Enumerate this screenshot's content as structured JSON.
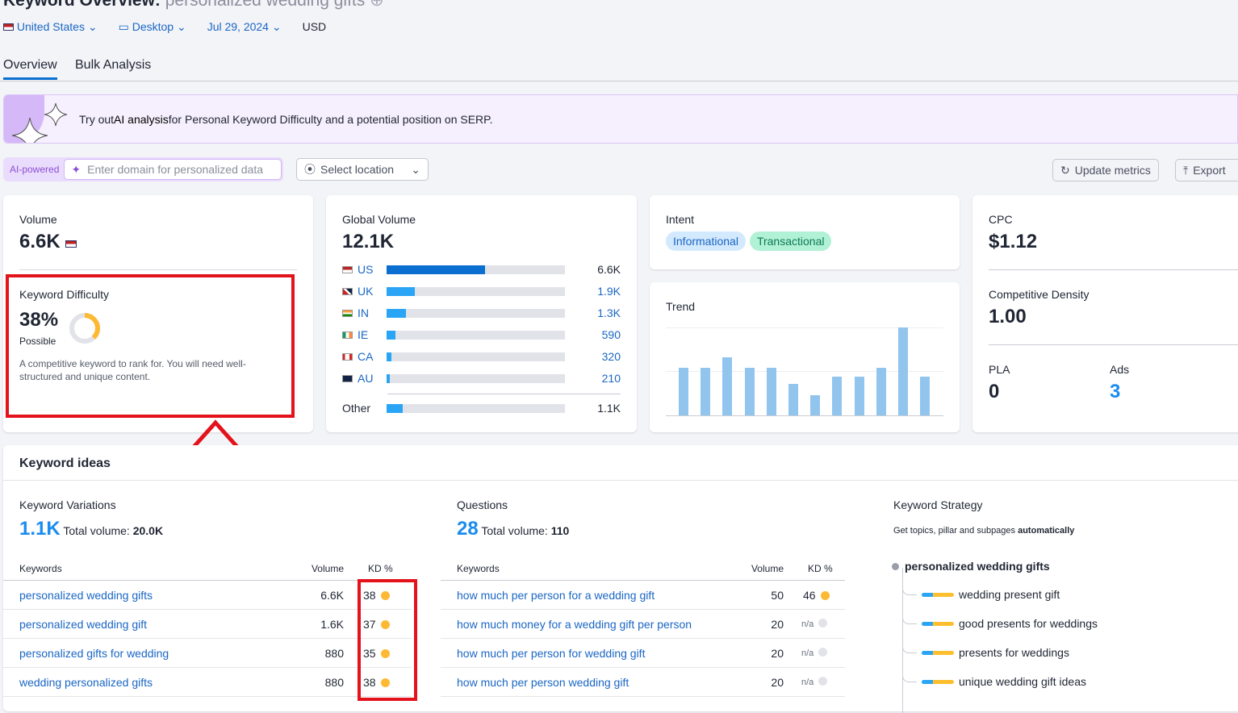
{
  "header": {
    "title": "Keyword Overview:",
    "keyword": "personalized wedding gifts",
    "country": "United States",
    "device": "Desktop",
    "date": "Jul 29, 2024",
    "currency": "USD"
  },
  "tabs": [
    {
      "label": "Overview",
      "active": true
    },
    {
      "label": "Bulk Analysis",
      "active": false
    }
  ],
  "banner": {
    "pre": "Try out ",
    "bold": "AI analysis",
    "post": " for Personal Keyword Difficulty and a potential position on SERP."
  },
  "personalize": {
    "badge": "AI-powered",
    "placeholder": "Enter domain for personalized data",
    "location": "Select location",
    "update": "Update metrics",
    "export": "Export"
  },
  "volume": {
    "label": "Volume",
    "value": "6.6K"
  },
  "kd": {
    "label": "Keyword Difficulty",
    "value": "38%",
    "level": "Possible",
    "percent": 38,
    "desc": "A competitive keyword to rank for. You will need well-structured and unique content.",
    "color": "#fdb934"
  },
  "global": {
    "label": "Global Volume",
    "value": "12.1K",
    "rows": [
      {
        "code": "US",
        "value": "6.6K",
        "fill": 0.55
      },
      {
        "code": "UK",
        "value": "1.9K",
        "fill": 0.16
      },
      {
        "code": "IN",
        "value": "1.3K",
        "fill": 0.11
      },
      {
        "code": "IE",
        "value": "590",
        "fill": 0.05
      },
      {
        "code": "CA",
        "value": "320",
        "fill": 0.027
      },
      {
        "code": "AU",
        "value": "210",
        "fill": 0.018
      }
    ],
    "other": {
      "label": "Other",
      "value": "1.1K",
      "fill": 0.09
    }
  },
  "intent": {
    "label": "Intent",
    "tags": [
      "Informational",
      "Transactional"
    ]
  },
  "trend": {
    "label": "Trend",
    "values": [
      0.54,
      0.54,
      0.66,
      0.54,
      0.54,
      0.36,
      0.23,
      0.44,
      0.44,
      0.54,
      1,
      0.44
    ]
  },
  "cpc": {
    "label": "CPC",
    "value": "$1.12"
  },
  "density": {
    "label": "Competitive Density",
    "value": "1.00"
  },
  "pla": {
    "label": "PLA",
    "value": "0"
  },
  "ads": {
    "label": "Ads",
    "value": "3"
  },
  "ideas": {
    "title": "Keyword ideas",
    "variations": {
      "label": "Keyword Variations",
      "count": "1.1K",
      "total_label": "Total volume:",
      "total": "20.0K",
      "cols": [
        "Keywords",
        "Volume",
        "KD %"
      ],
      "rows": [
        {
          "kw": "personalized wedding gifts",
          "vol": "6.6K",
          "kd": "38"
        },
        {
          "kw": "personalized wedding gift",
          "vol": "1.6K",
          "kd": "37"
        },
        {
          "kw": "personalized gifts for wedding",
          "vol": "880",
          "kd": "35"
        },
        {
          "kw": "wedding personalized gifts",
          "vol": "880",
          "kd": "38"
        }
      ]
    },
    "questions": {
      "label": "Questions",
      "count": "28",
      "total_label": "Total volume:",
      "total": "110",
      "cols": [
        "Keywords",
        "Volume",
        "KD %"
      ],
      "rows": [
        {
          "kw": "how much per person for a wedding gift",
          "vol": "50",
          "kd": "46"
        },
        {
          "kw": "how much money for a wedding gift per person",
          "vol": "20",
          "kd": "n/a"
        },
        {
          "kw": "how much per person for wedding gift",
          "vol": "20",
          "kd": "n/a"
        },
        {
          "kw": "how much per person wedding gift",
          "vol": "20",
          "kd": "n/a"
        }
      ]
    },
    "strategy": {
      "label": "Keyword Strategy",
      "desc_pre": "Get topics, pillar and subpages ",
      "desc_bold": "automatically",
      "root": "personalized wedding gifts",
      "items": [
        "wedding present gift",
        "good presents for weddings",
        "presents for weddings",
        "unique wedding gift ideas"
      ]
    }
  },
  "colors": {
    "accent": "#1a66c4",
    "kd_dot": "#fdb934",
    "na_dot": "#e1e3e9",
    "highlight": "#e3121b",
    "trend_bar": "#92c5ee"
  }
}
